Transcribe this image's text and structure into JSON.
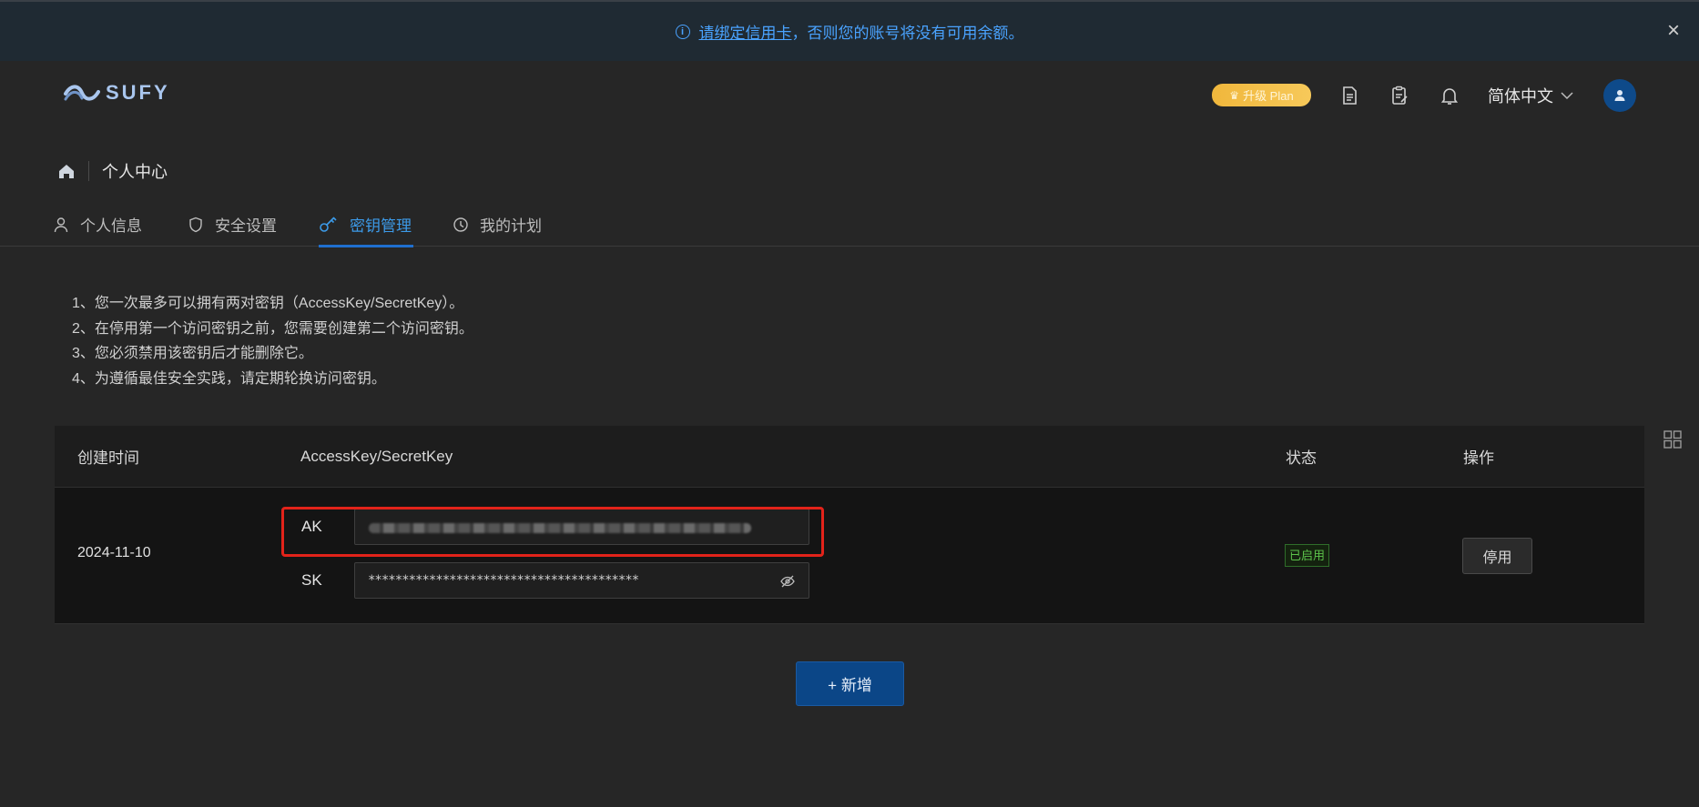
{
  "notice": {
    "icon": "info-icon",
    "link_text": "请绑定信用卡",
    "message": "，否则您的账号将没有可用余额。",
    "close_icon": "close-icon"
  },
  "header": {
    "logo_text": "SUFY",
    "plan_badge": "升级 Plan",
    "language": "简体中文",
    "icons": [
      "document-icon",
      "clipboard-icon",
      "bell-icon",
      "user-icon"
    ]
  },
  "breadcrumb": {
    "home_icon": "home-icon",
    "title": "个人中心"
  },
  "tabs": [
    {
      "label": "个人信息",
      "icon": "user-icon"
    },
    {
      "label": "安全设置",
      "icon": "shield-icon"
    },
    {
      "label": "密钥管理",
      "icon": "key-icon",
      "active": true
    },
    {
      "label": "我的计划",
      "icon": "clock-icon"
    }
  ],
  "notes": [
    "1、您一次最多可以拥有两对密钥（AccessKey/SecretKey）。",
    "2、在停用第一个访问密钥之前，您需要创建第二个访问密钥。",
    "3、您必须禁用该密钥后才能删除它。",
    "4、为遵循最佳安全实践，请定期轮换访问密钥。"
  ],
  "table": {
    "columns": [
      "创建时间",
      "AccessKey/SecretKey",
      "状态",
      "操作"
    ],
    "rows": [
      {
        "created": "2024-11-10",
        "ak_label": "AK",
        "sk_label": "SK",
        "sk_value": "****************************************",
        "status": "已启用",
        "action": "停用"
      }
    ]
  },
  "add_button": "+ 新增",
  "colors": {
    "accent": "#1f6fcf",
    "status_green": "#5cc24b",
    "highlight_red": "#e2231a"
  }
}
